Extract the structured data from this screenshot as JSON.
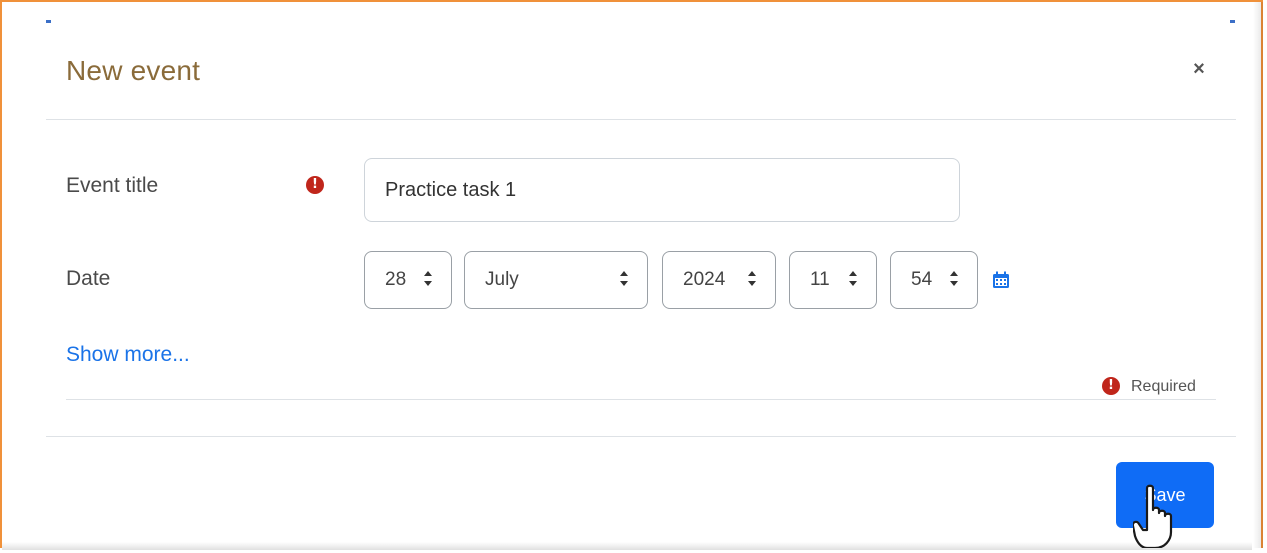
{
  "dialog": {
    "title": "New event",
    "close_label": "×"
  },
  "form": {
    "event_title_label": "Event title",
    "event_title_value": "Practice task 1",
    "date_label": "Date",
    "day": "28",
    "month": "July",
    "year": "2024",
    "hour": "11",
    "minute": "54",
    "show_more": "Show more...",
    "required_text": "Required",
    "error_icon_glyph": "!"
  },
  "footer": {
    "save_label": "Save"
  },
  "colors": {
    "frame_border": "#f0913a",
    "title": "#8a6b3a",
    "link": "#1a73e8",
    "save_button": "#0f6cf6",
    "error_icon": "#c0261b"
  },
  "icons": [
    "close-icon",
    "error-icon",
    "sort-arrows-icon",
    "calendar-icon",
    "pointer-hand-icon"
  ]
}
